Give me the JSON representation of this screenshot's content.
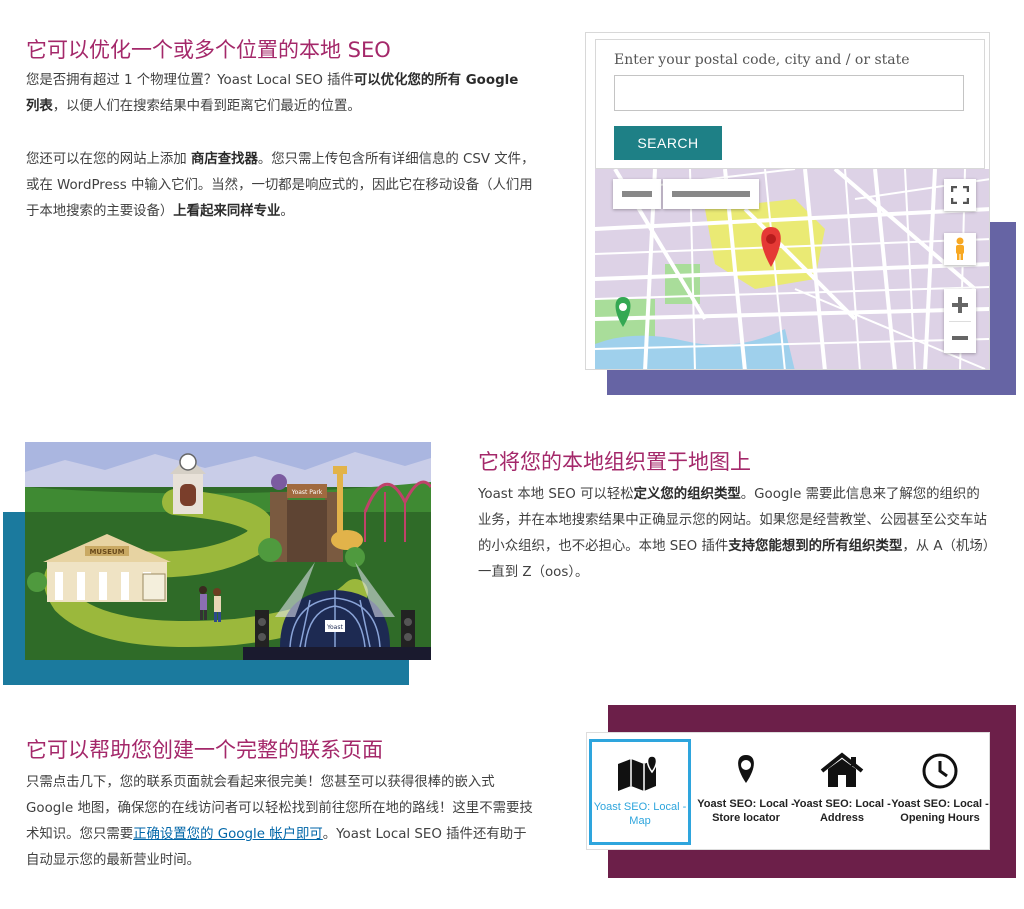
{
  "section_store": {
    "heading": "它可以优化一个或多个位置的本地 SEO",
    "p1_a": "您是否拥有超过 1 个物理位置？Yoast Local SEO 插件",
    "p1_bold": "可以优化您的所有 Google 列表",
    "p1_b": "，以便人们在搜索结果中看到距离它们最近的位置。",
    "p2_a": "您还可以在您的网站上添加 ",
    "p2_bold1": "商店查找器",
    "p2_b": "。您只需上传包含所有详细信息的 CSV 文件，或在 WordPress 中输入它们。当然，一切都是响应式的，因此它在移动设备（人们用于本地搜索的主要设备）",
    "p2_bold2": "上看起来同样专业",
    "p2_c": "。",
    "locator": {
      "label": "Enter your postal code, city and / or state",
      "button": "SEARCH"
    }
  },
  "section_org": {
    "heading": "它将您的本地组织置于地图上",
    "p_a": "Yoast 本地 SEO 可以轻松",
    "p_bold1": "定义您的组织类型",
    "p_b": "。Google 需要此信息来了解您的组织的业务，并在本地搜索结果中正确显示您的网站。如果您是经营教堂、公园甚至公交车站的小众组织，也不必担心。本地 SEO 插件",
    "p_bold2": "支持您能想到的所有组织类型",
    "p_c": "，从 A（机场）一直到 Z（oos）。",
    "illustration": {
      "museum_sign": "MUSEUM",
      "gate_sign": "Yoast Park",
      "tent_label": "Yoast"
    }
  },
  "section_contact": {
    "heading": "它可以帮助您创建一个完整的联系页面",
    "p_a": "只需点击几下，您的联系页面就会看起来很完美！您甚至可以获得很棒的嵌入式 Google 地图，确保您的在线访问者可以轻松找到前往您所在地的路线！这里不需要技术知识。您只需要",
    "p_link": "正确设置您的 Google 帐户即可",
    "p_b": "。Yoast Local SEO 插件还有助于自动显示您的最新营业时间。",
    "blocks": [
      {
        "label": "Yoast SEO: Local - Map",
        "icon": "map-icon"
      },
      {
        "label": "Yoast SEO: Local - Store locator",
        "icon": "map-pin-icon"
      },
      {
        "label": "Yoast SEO: Local - Address",
        "icon": "house-icon"
      },
      {
        "label": "Yoast SEO: Local - Opening Hours",
        "icon": "clock-icon"
      }
    ]
  },
  "colors": {
    "heading": "#a4286a",
    "purple": "#6664a4",
    "teal": "#1b7a9e",
    "wine": "#6c1f49",
    "button": "#1e8086",
    "active_block": "#2ea5dd"
  }
}
